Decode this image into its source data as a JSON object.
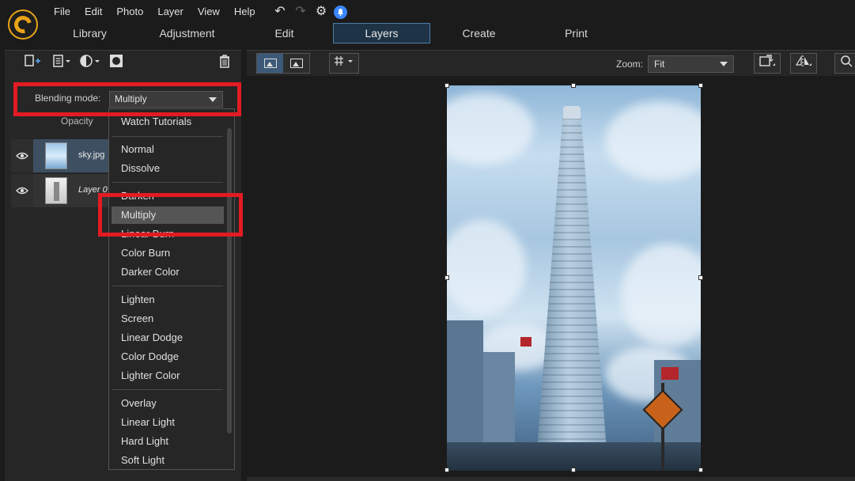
{
  "menubar": {
    "items": [
      "File",
      "Edit",
      "Photo",
      "Layer",
      "View",
      "Help"
    ]
  },
  "toolbar_glyphs": {
    "undo": "↶",
    "redo": "↷",
    "settings": "⚙",
    "notify": "🔔"
  },
  "tabs": [
    {
      "label": "Library",
      "active": false
    },
    {
      "label": "Adjustment",
      "active": false
    },
    {
      "label": "Edit",
      "active": false
    },
    {
      "label": "Layers",
      "active": true
    },
    {
      "label": "Create",
      "active": false
    },
    {
      "label": "Print",
      "active": false
    }
  ],
  "layers_panel": {
    "blending_label": "Blending mode:",
    "blending_value": "Multiply",
    "opacity_label": "Opacity",
    "layers": [
      {
        "name": "sky.jpg",
        "selected": true
      },
      {
        "name": "Layer 0",
        "selected": false
      }
    ]
  },
  "blend_dropdown": {
    "partial_top": "Watch Tutorials",
    "groups": [
      [
        "Normal",
        "Dissolve"
      ],
      [
        "Darken",
        "Multiply",
        "Linear Burn",
        "Color Burn",
        "Darker Color"
      ],
      [
        "Lighten",
        "Screen",
        "Linear Dodge",
        "Color Dodge",
        "Lighter Color"
      ],
      [
        "Overlay",
        "Linear Light",
        "Hard Light",
        "Soft Light"
      ]
    ],
    "highlighted": "Multiply",
    "visible": {
      "darken_partial": "Darken",
      "linear_burn_partial": "Linear Burn"
    }
  },
  "canvas_toolbar": {
    "zoom_label": "Zoom:",
    "zoom_value": "Fit"
  },
  "annotation_color": "#e31b23",
  "accent_color": "#4d7da8"
}
